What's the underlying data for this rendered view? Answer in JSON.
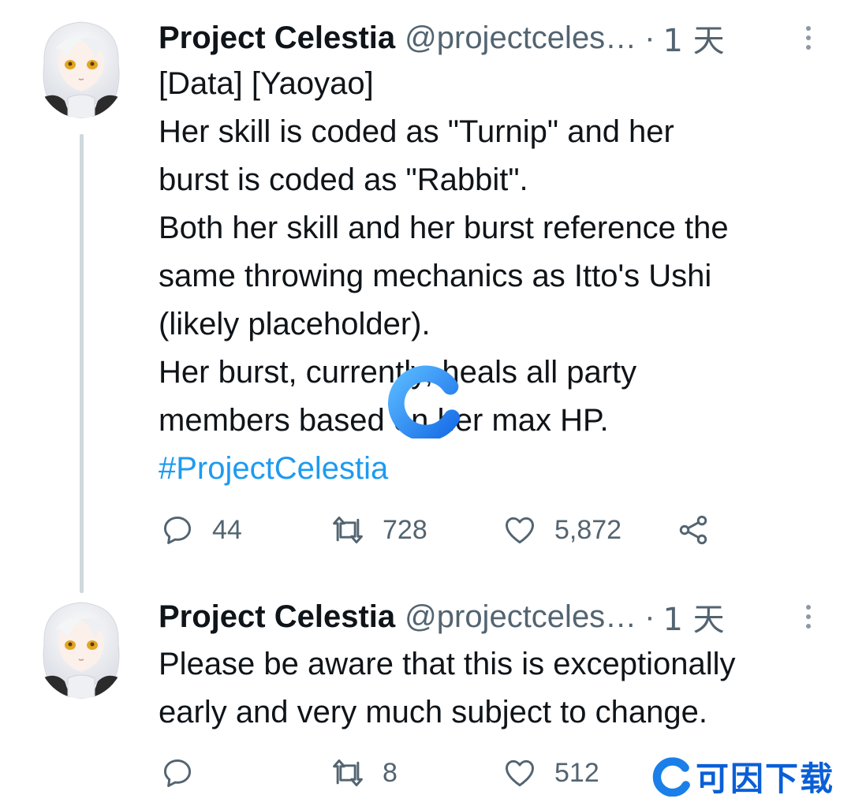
{
  "tweets": [
    {
      "display_name": "Project Celestia",
      "handle": "@projectceles…",
      "separator": "·",
      "time": "1 天",
      "lines": [
        "[Data] [Yaoyao]",
        "Her skill is coded as \"Turnip\" and her",
        "burst is coded as \"Rabbit\".",
        "Both her skill and her burst reference the",
        "same throwing mechanics as Itto's Ushi",
        "(likely placeholder).",
        "Her burst, currently, heals all party",
        "members based on her max HP."
      ],
      "hashtag": "#ProjectCelestia",
      "replies": "44",
      "retweets": "728",
      "likes": "5,872"
    },
    {
      "display_name": "Project Celestia",
      "handle": "@projectceles…",
      "separator": "·",
      "time": "1 天",
      "lines": [
        "Please be aware that this is exceptionally",
        "early and very much subject to change."
      ],
      "replies": "",
      "retweets": "8",
      "likes": "512"
    }
  ],
  "watermark": {
    "text": "可因下载"
  },
  "icons": {
    "reply": "reply-icon",
    "retweet": "retweet-icon",
    "like": "heart-icon",
    "share": "share-icon",
    "more": "more-icon",
    "loading": "loading-spinner-icon"
  },
  "colors": {
    "text": "#0f1419",
    "secondary": "#536471",
    "hashtag": "#1d9bf0",
    "thread_line": "#cfd9de",
    "spinner": "#1a8fff"
  }
}
